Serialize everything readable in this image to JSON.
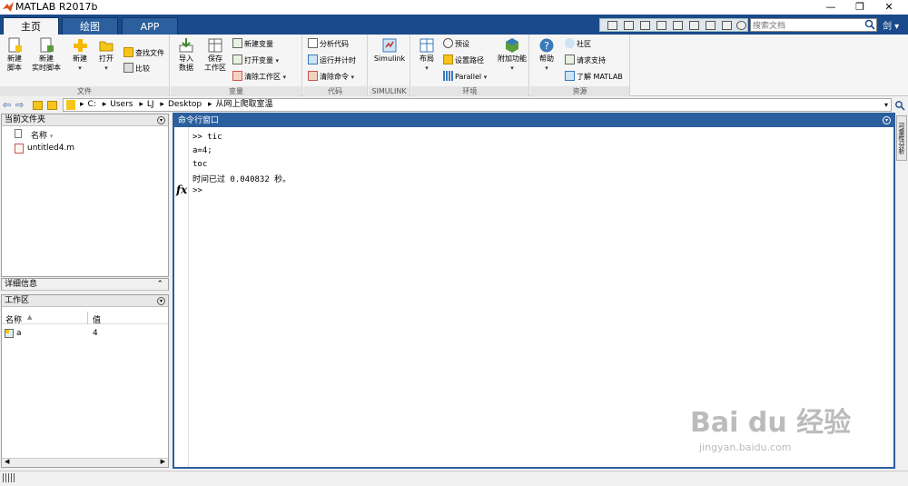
{
  "window": {
    "title": "MATLAB R2017b",
    "buttons": {
      "minimize": "—",
      "maximize": "❐",
      "close": "✕"
    }
  },
  "tabs": [
    {
      "label": "主页",
      "active": true
    },
    {
      "label": "绘图",
      "active": false
    },
    {
      "label": "APP",
      "active": false
    }
  ],
  "search": {
    "placeholder": "搜索文档"
  },
  "user": "剑 ▾",
  "ribbon": {
    "file": {
      "label": "文件",
      "new_script": "新建\n脚本",
      "new_live_script": "新建\n实时脚本",
      "new": "新建",
      "open": "打开",
      "find_files": "查找文件",
      "compare": "比较"
    },
    "variable": {
      "label": "变量",
      "import_data": "导入\n数据",
      "save_workspace": "保存\n工作区",
      "new_variable": "新建变量",
      "open_variable": "打开变量",
      "clear_workspace": "清除工作区"
    },
    "code": {
      "label": "代码",
      "analyze": "分析代码",
      "run_time": "运行并计时",
      "clear_commands": "清除命令"
    },
    "simulink": {
      "label": "SIMULINK",
      "simulink": "Simulink"
    },
    "environment": {
      "label": "环境",
      "layout": "布局",
      "preferences": "预设",
      "set_path": "设置路径",
      "parallel": "Parallel",
      "addons": "附加功能"
    },
    "resources": {
      "label": "资源",
      "help": "帮助",
      "community": "社区",
      "request_support": "请求支持",
      "learn_matlab": "了解 MATLAB"
    }
  },
  "address": {
    "crumbs": [
      "C:",
      "Users",
      "LJ",
      "Desktop",
      "从网上爬取室温"
    ]
  },
  "current_folder": {
    "title": "当前文件夹",
    "column_name": "名称",
    "files": [
      {
        "name": "untitled4.m"
      }
    ]
  },
  "details": {
    "title": "详细信息"
  },
  "workspace": {
    "title": "工作区",
    "col_name": "名称",
    "col_value": "值",
    "vars": [
      {
        "name": "a",
        "value": "4"
      }
    ]
  },
  "command_window": {
    "title": "命令行窗口",
    "lines": [
      ">> tic",
      "a=4;",
      "toc",
      "时间已过 0.040832 秒。"
    ],
    "prompt": ">>",
    "fx": "fx"
  },
  "side_panel": {
    "label": "可靠性分析"
  },
  "watermark": {
    "brand": "Bai du 经验",
    "url": "jingyan.baidu.com"
  },
  "colors": {
    "tab_bar": "#1a4a8a",
    "cmd_head": "#2c5f9e"
  }
}
